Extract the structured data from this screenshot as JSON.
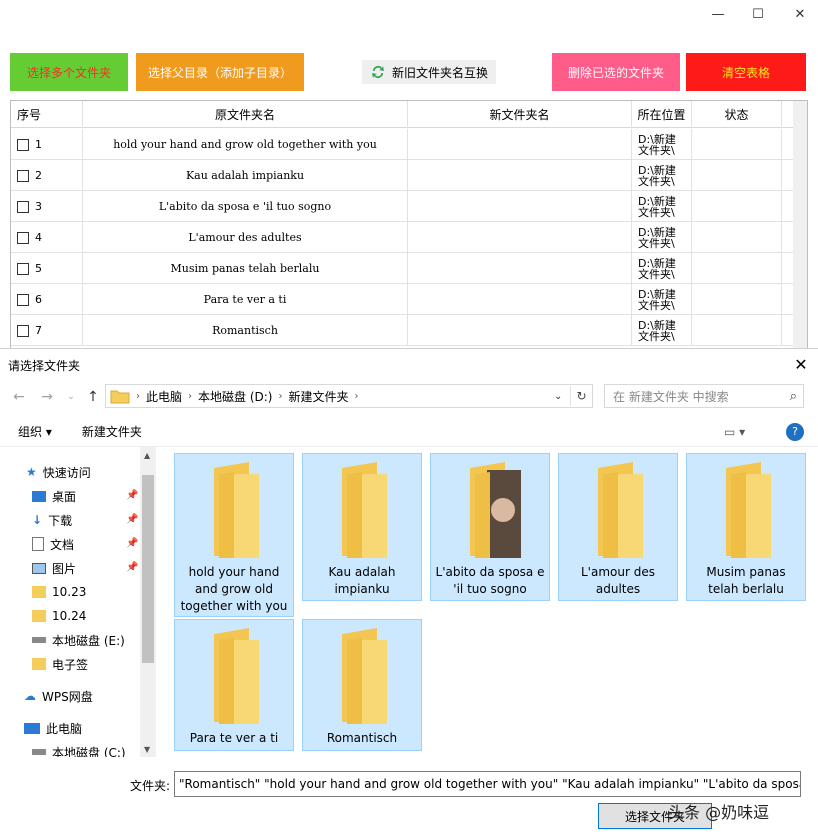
{
  "window": {
    "min": "—",
    "max": "☐",
    "close": "✕"
  },
  "toolbar": {
    "select_multi": "选择多个文件夹",
    "select_parent": "选择父目录（添加子目录）",
    "swap": "新旧文件夹名互换",
    "delete_selected": "删除已选的文件夹",
    "clear_table": "清空表格"
  },
  "colors": {
    "green": "#66cc33",
    "orange": "#f09a1e",
    "pink": "#ff5c8a",
    "red": "#ff1a1a",
    "accent": "#0078d7",
    "tile": "#cce8ff"
  },
  "table": {
    "headers": [
      "序号",
      "原文件夹名",
      "新文件夹名",
      "所在位置",
      "状态"
    ],
    "rows": [
      {
        "n": "1",
        "name": "hold your hand and grow old together with you",
        "loc1": "D:\\新建",
        "loc2": "文件夹\\"
      },
      {
        "n": "2",
        "name": "Kau adalah impianku",
        "loc1": "D:\\新建",
        "loc2": "文件夹\\"
      },
      {
        "n": "3",
        "name": "L'abito da sposa e 'il tuo sogno",
        "loc1": "D:\\新建",
        "loc2": "文件夹\\"
      },
      {
        "n": "4",
        "name": "L'amour des adultes",
        "loc1": "D:\\新建",
        "loc2": "文件夹\\"
      },
      {
        "n": "5",
        "name": "Musim panas telah berlalu",
        "loc1": "D:\\新建",
        "loc2": "文件夹\\"
      },
      {
        "n": "6",
        "name": "Para te ver a ti",
        "loc1": "D:\\新建",
        "loc2": "文件夹\\"
      },
      {
        "n": "7",
        "name": "Romantisch",
        "loc1": "D:\\新建",
        "loc2": "文件夹\\"
      }
    ]
  },
  "dialog": {
    "title": "请选择文件夹",
    "breadcrumb": [
      "此电脑",
      "本地磁盘 (D:)",
      "新建文件夹"
    ],
    "search_placeholder": "在 新建文件夹 中搜索",
    "organize": "组织",
    "new_folder": "新建文件夹",
    "nav": [
      "快速访问",
      "桌面",
      "下载",
      "文档",
      "图片",
      "10.23",
      "10.24",
      "本地磁盘 (E:)",
      "电子签",
      "WPS网盘",
      "此电脑",
      "本地磁盘 (C:)"
    ],
    "folders": [
      "hold your hand and grow old together with you",
      "Kau adalah impianku",
      "L'abito da sposa e 'il tuo sogno",
      "L'amour des adultes",
      "Musim panas telah berlalu",
      "Para te ver a ti",
      "Romantisch"
    ],
    "filename_label": "文件夹:",
    "filename_value": "\"Romantisch\" \"hold your hand and grow old together with you\" \"Kau adalah impianku\" \"L'abito da sposa e 'il tuo sogno\"",
    "select_button": "选择文件夹",
    "watermark": "头条 @奶味逗"
  }
}
